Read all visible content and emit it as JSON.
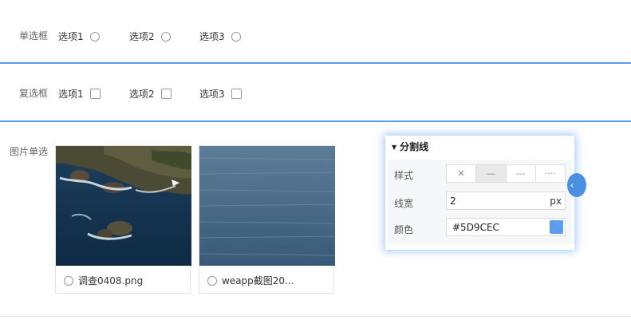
{
  "radio_row": {
    "label": "单选框",
    "options": [
      "选项1",
      "选项2",
      "选项3"
    ]
  },
  "checkbox_row": {
    "label": "复选框",
    "options": [
      "选项1",
      "选项2",
      "选项3"
    ]
  },
  "image_row": {
    "label": "图片单选",
    "cards": [
      {
        "name": "调查0408.png"
      },
      {
        "name": "weapp截图20..."
      }
    ]
  },
  "panel": {
    "title": "分割线",
    "style_label": "样式",
    "style_options": [
      "✕",
      "—",
      "---",
      "····"
    ],
    "width_label": "线宽",
    "width_value": "2",
    "width_unit": "px",
    "color_label": "颜色",
    "color_value": "#5D9CEC"
  },
  "colors": {
    "accent": "#5D9CEC"
  }
}
